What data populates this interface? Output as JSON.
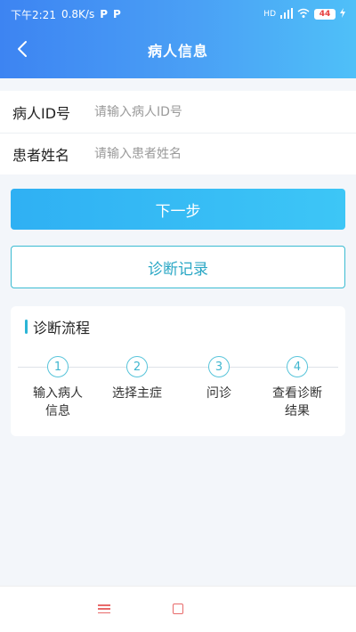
{
  "status_bar": {
    "time": "下午2:21",
    "speed": "0.8K/s",
    "p_icon_1": "P",
    "p_icon_2": "P",
    "signal_text": "HD",
    "battery": "44"
  },
  "nav": {
    "title": "病人信息"
  },
  "form": {
    "patient_id": {
      "label": "病人ID号",
      "placeholder": "请输入病人ID号",
      "value": ""
    },
    "patient_name": {
      "label": "患者姓名",
      "placeholder": "请输入患者姓名",
      "value": ""
    }
  },
  "buttons": {
    "next": "下一步",
    "records": "诊断记录"
  },
  "flow": {
    "title": "诊断流程",
    "steps": [
      {
        "num": "1",
        "label": "输入病人信息"
      },
      {
        "num": "2",
        "label": "选择主症"
      },
      {
        "num": "3",
        "label": "问诊"
      },
      {
        "num": "4",
        "label": "查看诊断结果"
      }
    ]
  },
  "colors": {
    "header_start": "#3d84f2",
    "header_end": "#4fc0f8",
    "accent": "#2bb5d6",
    "nav_icon": "#e86a6a"
  }
}
